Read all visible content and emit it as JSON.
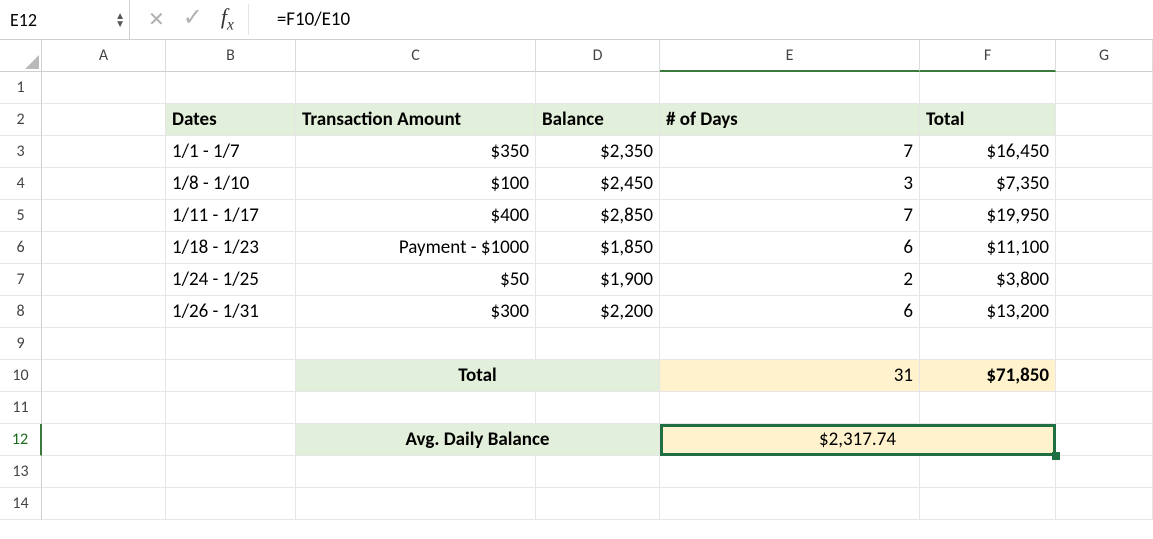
{
  "formula_bar": {
    "name_box": "E12",
    "formula": "=F10/E10"
  },
  "columns": [
    "A",
    "B",
    "C",
    "D",
    "E",
    "F",
    "G"
  ],
  "row_count": 14,
  "selected_cell": "E12",
  "headers": {
    "dates": "Dates",
    "transaction": "Transaction Amount",
    "balance": "Balance",
    "days": "# of Days",
    "total": "Total"
  },
  "rows": [
    {
      "dates": "1/1 - 1/7",
      "transaction": "$350",
      "balance": "$2,350",
      "days": "7",
      "total": "$16,450"
    },
    {
      "dates": "1/8 - 1/10",
      "transaction": "$100",
      "balance": "$2,450",
      "days": "3",
      "total": "$7,350"
    },
    {
      "dates": "1/11 - 1/17",
      "transaction": "$400",
      "balance": "$2,850",
      "days": "7",
      "total": "$19,950"
    },
    {
      "dates": "1/18 - 1/23",
      "transaction": "Payment - $1000",
      "balance": "$1,850",
      "days": "6",
      "total": "$11,100"
    },
    {
      "dates": "1/24 - 1/25",
      "transaction": "$50",
      "balance": "$1,900",
      "days": "2",
      "total": "$3,800"
    },
    {
      "dates": "1/26 - 1/31",
      "transaction": "$300",
      "balance": "$2,200",
      "days": "6",
      "total": "$13,200"
    }
  ],
  "totals": {
    "label": "Total",
    "days": "31",
    "total": "$71,850",
    "avg_label": "Avg. Daily Balance",
    "avg_value": "$2,317.74"
  },
  "chart_data": {
    "type": "table",
    "title": "Credit-card average daily balance calculation",
    "columns": [
      "Dates",
      "Transaction Amount",
      "Balance",
      "# of Days",
      "Total"
    ],
    "data": [
      [
        "1/1 - 1/7",
        350,
        2350,
        7,
        16450
      ],
      [
        "1/8 - 1/10",
        100,
        2450,
        3,
        7350
      ],
      [
        "1/11 - 1/17",
        400,
        2850,
        7,
        19950
      ],
      [
        "1/18 - 1/23",
        -1000,
        1850,
        6,
        11100
      ],
      [
        "1/24 - 1/25",
        50,
        1900,
        2,
        3800
      ],
      [
        "1/26 - 1/31",
        300,
        2200,
        6,
        13200
      ]
    ],
    "totals": {
      "days": 31,
      "sum_total": 71850
    },
    "avg_daily_balance": 2317.74,
    "formula": "=F10/E10"
  }
}
